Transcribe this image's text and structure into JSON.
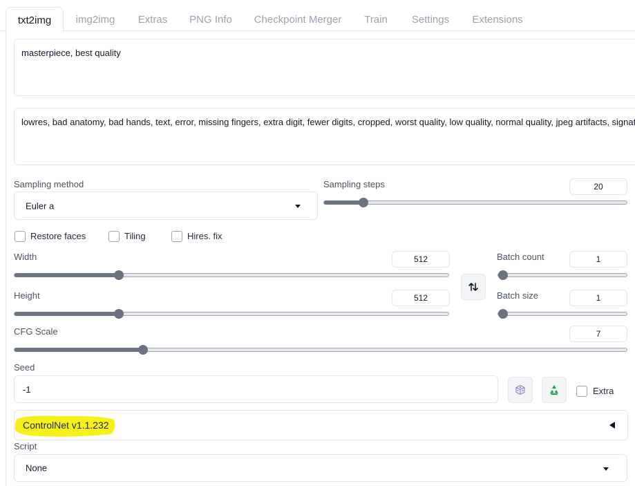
{
  "tabs": [
    "txt2img",
    "img2img",
    "Extras",
    "PNG Info",
    "Checkpoint Merger",
    "Train",
    "Settings",
    "Extensions"
  ],
  "prompt": {
    "value": "masterpiece, best quality"
  },
  "negative_prompt": {
    "value": "lowres, bad anatomy, bad hands, text, error, missing fingers, extra digit, fewer digits, cropped, worst quality, low quality, normal quality, jpeg artifacts, signature, watermark, username, blurry"
  },
  "sampling": {
    "method_label": "Sampling method",
    "method_value": "Euler a",
    "steps_label": "Sampling steps",
    "steps_value": "20",
    "steps_fraction": 0.13
  },
  "options": {
    "restore_faces": "Restore faces",
    "tiling": "Tiling",
    "hires_fix": "Hires. fix"
  },
  "dimensions": {
    "width_label": "Width",
    "width_value": "512",
    "width_fraction": 0.24,
    "height_label": "Height",
    "height_value": "512",
    "height_fraction": 0.24
  },
  "batch": {
    "count_label": "Batch count",
    "count_value": "1",
    "size_label": "Batch size",
    "size_value": "1"
  },
  "cfg": {
    "label": "CFG Scale",
    "value": "7",
    "fraction": 0.21
  },
  "seed": {
    "label": "Seed",
    "value": "-1",
    "extra_label": "Extra"
  },
  "controlnet": {
    "label": "ControlNet v1.1.232"
  },
  "script": {
    "label": "Script",
    "value": "None"
  },
  "colors": {
    "highlight": "#f7f01a"
  }
}
